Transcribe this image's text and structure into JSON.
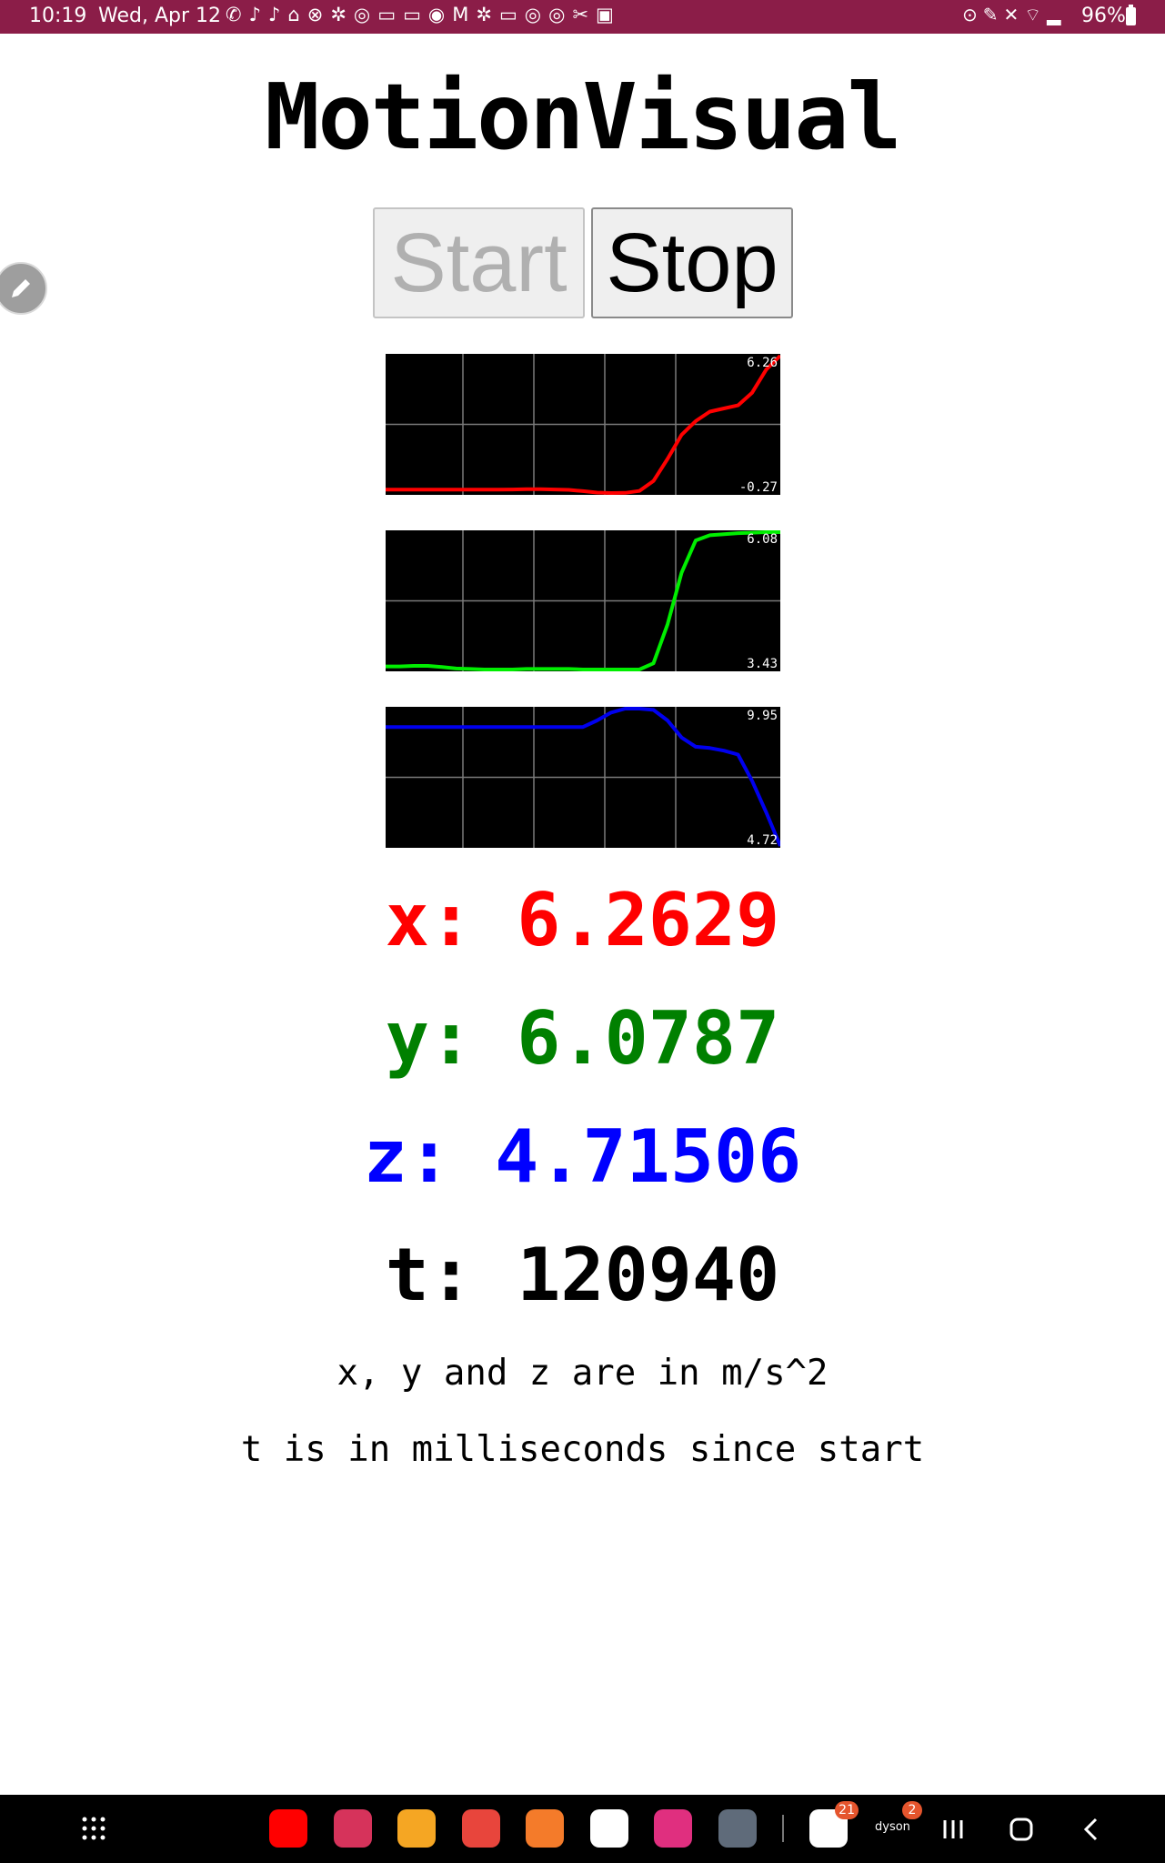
{
  "status_bar": {
    "time": "10:19",
    "date": "Wed, Apr 12",
    "notification_icons": "✆♪♪⌂⊗✲◎▭▭◉M✲▭◎◎✂▣",
    "system_icons": "⊙✎✕⌔▂",
    "battery": "96%"
  },
  "app": {
    "title": "MotionVisual",
    "start_label": "Start",
    "stop_label": "Stop"
  },
  "graphs": [
    {
      "axis": "x",
      "max_label": "6.26",
      "min_label": "-0.27",
      "color": "#ff0000",
      "values": [
        -0.11,
        -0.11,
        -0.11,
        -0.11,
        -0.11,
        -0.11,
        -0.11,
        -0.11,
        -0.11,
        -0.1,
        -0.09,
        -0.09,
        -0.1,
        -0.12,
        -0.18,
        -0.25,
        -0.27,
        -0.26,
        -0.17,
        0.3,
        1.35,
        2.5,
        3.15,
        3.6,
        3.75,
        3.9,
        4.5,
        5.6,
        6.26
      ]
    },
    {
      "axis": "y",
      "max_label": "6.08",
      "min_label": "3.43",
      "color": "#00ee00",
      "values": [
        3.49,
        3.49,
        3.5,
        3.5,
        3.48,
        3.45,
        3.44,
        3.43,
        3.43,
        3.43,
        3.44,
        3.44,
        3.44,
        3.44,
        3.43,
        3.43,
        3.43,
        3.43,
        3.43,
        3.55,
        4.3,
        5.3,
        5.92,
        6.02,
        6.04,
        6.06,
        6.07,
        6.08,
        6.08
      ]
    },
    {
      "axis": "z",
      "max_label": "9.95",
      "min_label": "4.72",
      "color": "#0000ee",
      "values": [
        9.25,
        9.25,
        9.25,
        9.25,
        9.25,
        9.25,
        9.25,
        9.25,
        9.25,
        9.25,
        9.25,
        9.25,
        9.25,
        9.25,
        9.25,
        9.5,
        9.8,
        9.95,
        9.95,
        9.9,
        9.5,
        8.85,
        8.5,
        8.45,
        8.35,
        8.2,
        7.2,
        6.0,
        4.72
      ]
    }
  ],
  "readouts": {
    "x": "x: 6.2629",
    "y": "y: 6.0787",
    "z": "z: 4.71506",
    "t": "t: 120940",
    "x_color": "#ff0000",
    "y_color": "#008000",
    "z_color": "#0000ff",
    "t_color": "#000000"
  },
  "notes": {
    "units": "x, y and z are in m/s^2",
    "time": "t is in milliseconds since start"
  },
  "nav_bar": {
    "apps": [
      {
        "name": "app-drawer-icon",
        "color": "#000000"
      },
      {
        "name": "youtube-icon",
        "color": "#ff0000"
      },
      {
        "name": "camera-icon",
        "color": "#d6335b"
      },
      {
        "name": "files-icon",
        "color": "#f5a623"
      },
      {
        "name": "notes-icon",
        "color": "#e8453c"
      },
      {
        "name": "contacts-icon",
        "color": "#f47b2a"
      },
      {
        "name": "chrome-icon",
        "color": "#ffffff"
      },
      {
        "name": "gallery-icon",
        "color": "#e02f7f"
      },
      {
        "name": "settings-icon",
        "color": "#5f6b7a"
      },
      {
        "name": "google-home-icon",
        "color": "#ffffff",
        "badge": "21"
      },
      {
        "name": "dyson-icon",
        "color": "#000000",
        "badge": "2"
      }
    ],
    "dyson_label": "dyson"
  }
}
